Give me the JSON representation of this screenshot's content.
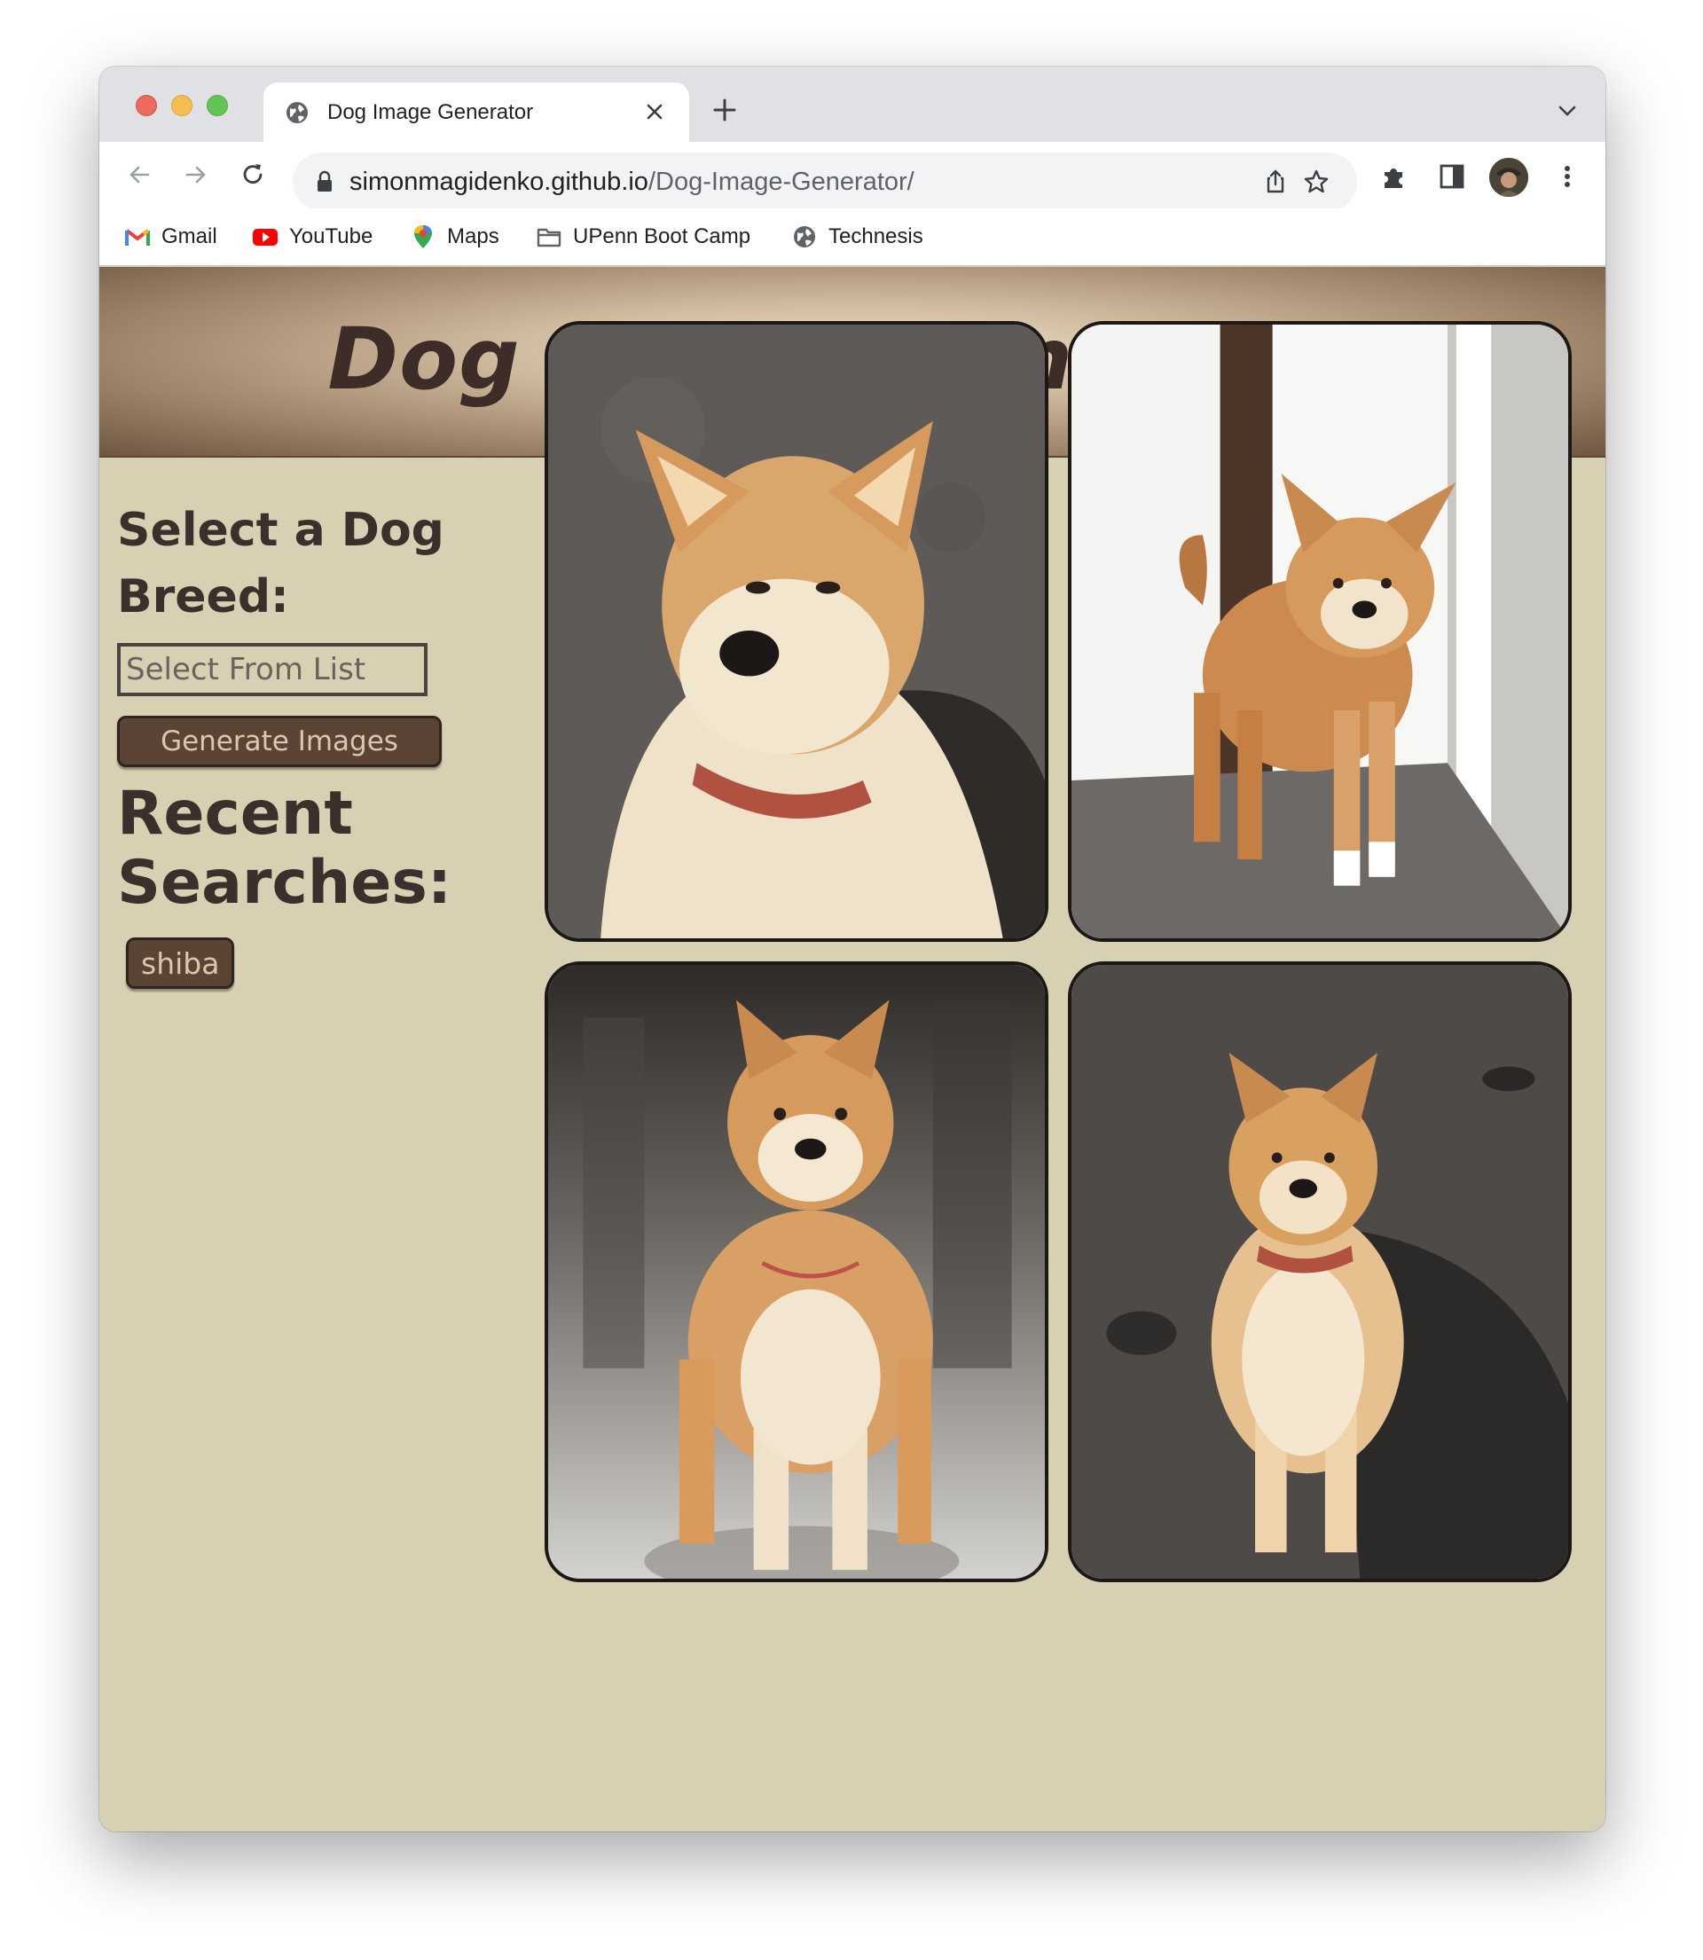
{
  "browser": {
    "tab_title": "Dog Image Generator",
    "url_host": "simonmagidenko.github.io",
    "url_path": "/Dog-Image-Generator/",
    "bookmarks": [
      {
        "label": "Gmail",
        "icon": "gmail-icon"
      },
      {
        "label": "YouTube",
        "icon": "youtube-icon"
      },
      {
        "label": "Maps",
        "icon": "maps-icon"
      },
      {
        "label": "UPenn Boot Camp",
        "icon": "folder-icon"
      },
      {
        "label": "Technesis",
        "icon": "globe-icon"
      }
    ]
  },
  "page": {
    "title": "Dog Image Generator",
    "select_heading": "Select a Dog Breed:",
    "breed_input_placeholder": "Select From List",
    "generate_button": "Generate Images",
    "recent_heading": "Recent Searches:",
    "recent_searches": [
      "shiba"
    ]
  },
  "colors": {
    "page_background": "#d8d0b2",
    "button_brown": "#5b4435",
    "heading_text": "#3b302b"
  }
}
